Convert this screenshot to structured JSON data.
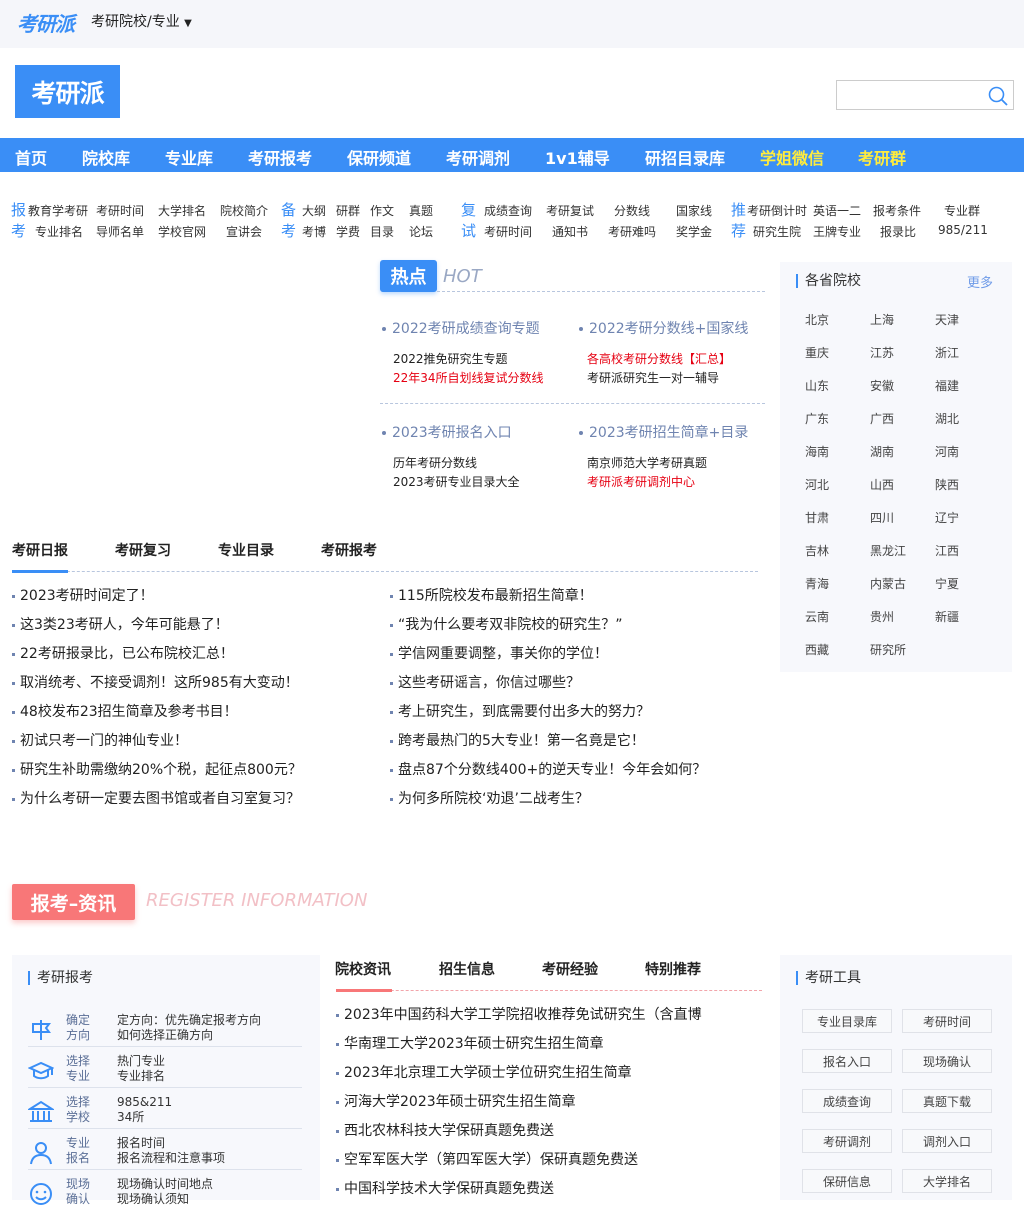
{
  "topbar": {
    "logo": "考研派",
    "dropdown": "考研院校/专业"
  },
  "header": {
    "logo": "考研派",
    "search_placeholder": ""
  },
  "nav": [
    {
      "label": "首页"
    },
    {
      "label": "院校库"
    },
    {
      "label": "专业库"
    },
    {
      "label": "考研报考"
    },
    {
      "label": "保研频道"
    },
    {
      "label": "考研调剂"
    },
    {
      "label": "1v1辅导"
    },
    {
      "label": "研招目录库"
    },
    {
      "label": "学姐微信"
    },
    {
      "label": "考研群"
    }
  ],
  "quick": {
    "g1": {
      "h1": "报",
      "h2": "考",
      "r1": [
        "教育学考研",
        "考研时间",
        "大学排名",
        "院校简介"
      ],
      "r2": [
        "专业排名",
        "导师名单",
        "学校官网",
        "宣讲会"
      ]
    },
    "g2": {
      "h1": "备",
      "h2": "考",
      "r1": [
        "大纲",
        "研群",
        "作文",
        "真题"
      ],
      "r2": [
        "考博",
        "学费",
        "目录",
        "论坛"
      ]
    },
    "g3": {
      "h1": "复",
      "h2": "试",
      "r1": [
        "成绩查询",
        "考研复试",
        "分数线",
        "国家线"
      ],
      "r2": [
        "考研时间",
        "通知书",
        "考研难吗",
        "奖学金"
      ]
    },
    "g4": {
      "h1": "推",
      "h2": "荐",
      "r1": [
        "考研倒计时",
        "英语一二",
        "报考条件",
        "专业群"
      ],
      "r2": [
        "研究生院",
        "王牌专业",
        "报录比",
        "985/211"
      ]
    }
  },
  "hot": {
    "badge": "热点",
    "en": "HOT",
    "blocks": [
      {
        "title": "2022考研成绩查询专题",
        "l1": "2022推免研究生专题",
        "l2": "22年34所自划线复试分数线"
      },
      {
        "title": "2022考研分数线+国家线",
        "l1": "各高校考研分数线【汇总】",
        "l2": "考研派研究生一对一辅导"
      },
      {
        "title": "2023考研报名入口",
        "l1": "历年考研分数线",
        "l2": "2023考研专业目录大全"
      },
      {
        "title": "2023考研招生简章+目录",
        "l1": "南京师范大学考研真题",
        "l2": "考研派考研调剂中心"
      }
    ]
  },
  "provinces": {
    "title": "各省院校",
    "more": "更多",
    "items": [
      "北京",
      "上海",
      "天津",
      "重庆",
      "江苏",
      "浙江",
      "山东",
      "安徽",
      "福建",
      "广东",
      "广西",
      "湖北",
      "海南",
      "湖南",
      "河南",
      "河北",
      "山西",
      "陕西",
      "甘肃",
      "四川",
      "辽宁",
      "吉林",
      "黑龙江",
      "江西",
      "青海",
      "内蒙古",
      "宁夏",
      "云南",
      "贵州",
      "新疆",
      "西藏",
      "研究所"
    ]
  },
  "daily": {
    "tabs": [
      "考研日报",
      "考研复习",
      "专业目录",
      "考研报考"
    ],
    "left": [
      "2023考研时间定了！",
      "这3类23考研人，今年可能悬了！",
      "22考研报录比，已公布院校汇总！",
      "取消统考、不接受调剂！这所985有大变动！",
      "48校发布23招生简章及参考书目！",
      "初试只考一门的神仙专业！",
      "研究生补助需缴纳20%个税，起征点800元？",
      "为什么考研一定要去图书馆或者自习室复习？"
    ],
    "right": [
      "115所院校发布最新招生简章！",
      "“我为什么要考双非院校的研究生？”",
      "学信网重要调整，事关你的学位！",
      "这些考研谣言，你信过哪些？",
      "考上研究生，到底需要付出多大的努力？",
      "跨考最热门的5大专业！第一名竟是它！",
      "盘点87个分数线400+的逆天专业！今年会如何？",
      "为何多所院校‘劝退’二战考生？"
    ]
  },
  "banner": {
    "cn": "报考–资讯",
    "en": "REGISTER INFORMATION"
  },
  "steps": {
    "title": "考研报考",
    "items": [
      {
        "icon": "signpost-icon",
        "l1": "确定",
        "l2": "方向",
        "t1": "定方向：优先确定报考方向",
        "t2": "如何选择正确方向"
      },
      {
        "icon": "graduation-cap-icon",
        "l1": "选择",
        "l2": "专业",
        "t1": "热门专业",
        "t2": "专业排名"
      },
      {
        "icon": "school-building-icon",
        "l1": "选择",
        "l2": "学校",
        "t1": "985&211",
        "t2": "34所"
      },
      {
        "icon": "person-icon",
        "l1": "专业",
        "l2": "报名",
        "t1": "报名时间",
        "t2": "报名流程和注意事项"
      },
      {
        "icon": "smile-icon",
        "l1": "现场",
        "l2": "确认",
        "t1": "现场确认时间地点",
        "t2": "现场确认须知"
      }
    ]
  },
  "info": {
    "tabs": [
      "院校资讯",
      "招生信息",
      "考研经验",
      "特别推荐"
    ],
    "items": [
      "2023年中国药科大学工学院招收推荐免试研究生（含直博",
      "华南理工大学2023年硕士研究生招生简章",
      "2023年北京理工大学硕士学位研究生招生简章",
      "河海大学2023年硕士研究生招生简章",
      "西北农林科技大学保研真题免费送",
      "空军军医大学（第四军医大学）保研真题免费送",
      "中国科学技术大学保研真题免费送"
    ]
  },
  "tools": {
    "title": "考研工具",
    "items": [
      "专业目录库",
      "考研时间",
      "报名入口",
      "现场确认",
      "成绩查询",
      "真题下载",
      "考研调剂",
      "调剂入口",
      "保研信息",
      "大学排名"
    ]
  },
  "colors": {
    "primary": "#3a8ef6",
    "accent_yellow": "#ffec3d",
    "red": "#e60012",
    "pink": "#f87778"
  }
}
